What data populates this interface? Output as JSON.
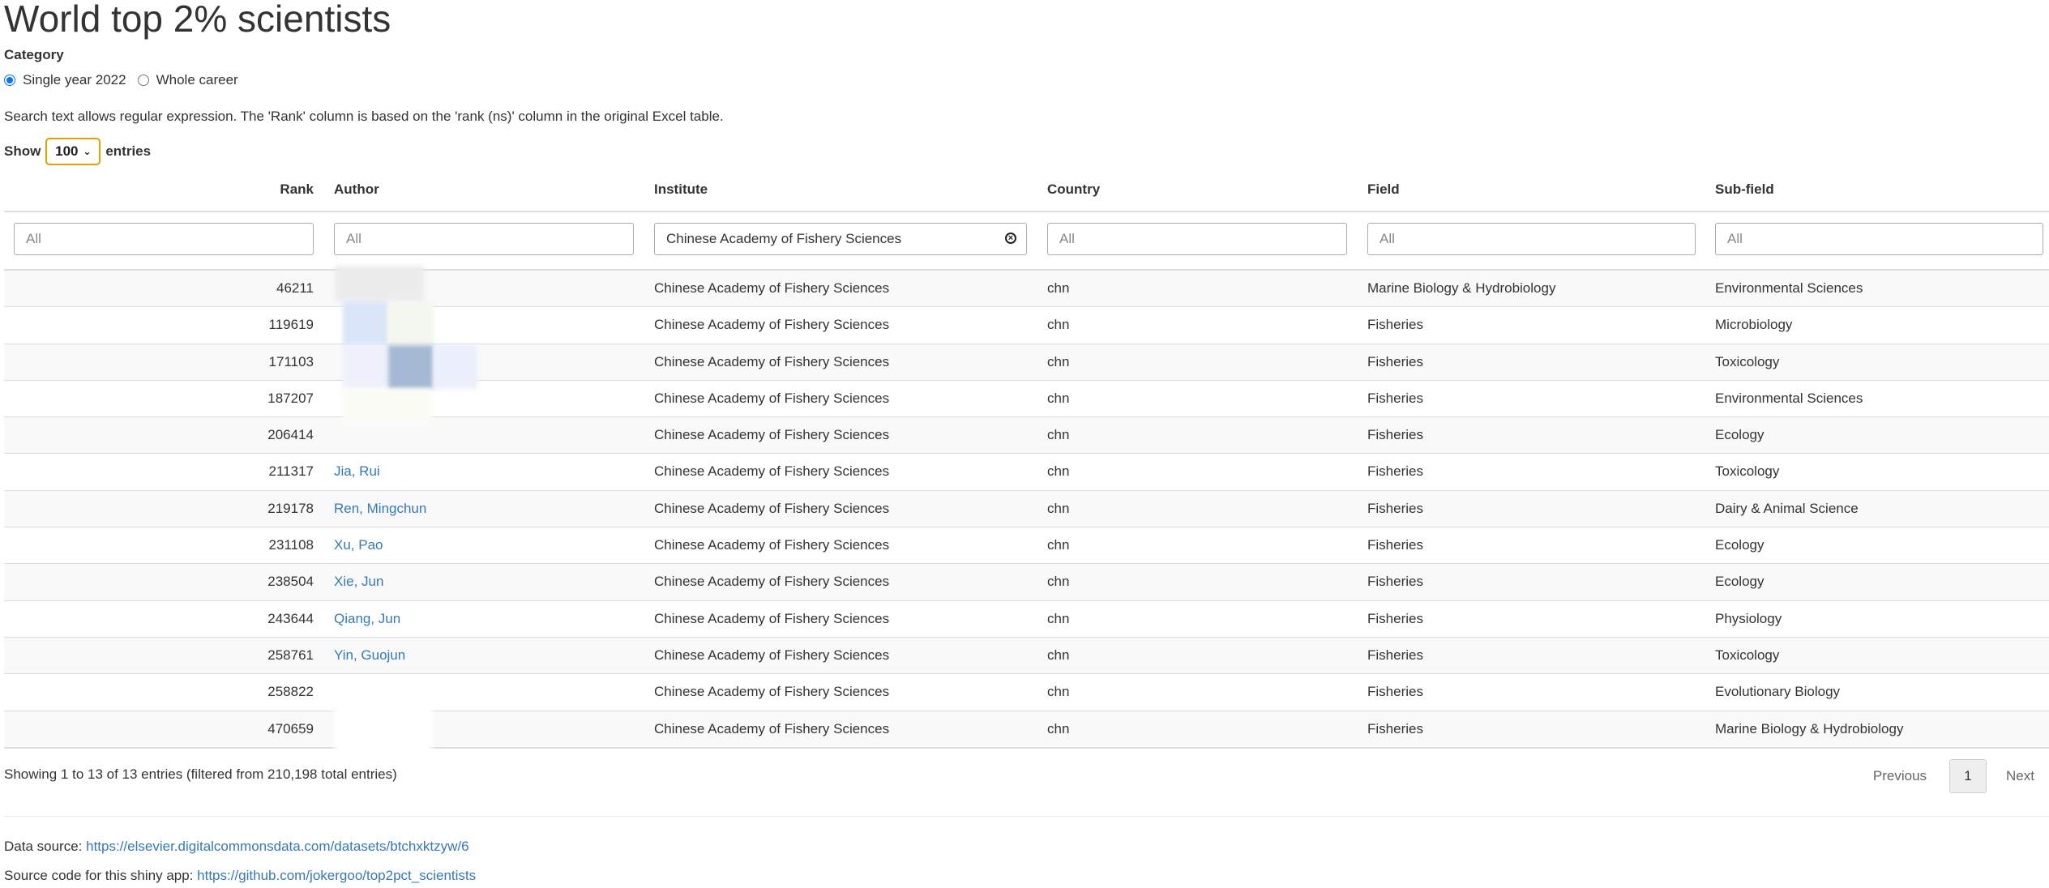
{
  "title": "World top 2% scientists",
  "category": {
    "label": "Category",
    "options": [
      {
        "label": "Single year 2022",
        "checked": true
      },
      {
        "label": "Whole career",
        "checked": false
      }
    ]
  },
  "search_help": "Search text allows regular expression. The 'Rank' column is based on the 'rank (ns)' column in the original Excel table.",
  "length_menu": {
    "show": "Show",
    "value": "100",
    "entries": "entries"
  },
  "columns": [
    "Rank",
    "Author",
    "Institute",
    "Country",
    "Field",
    "Sub-field"
  ],
  "filters": [
    {
      "value": "",
      "placeholder": "All"
    },
    {
      "value": "",
      "placeholder": "All"
    },
    {
      "value": "Chinese Academy of Fishery Sciences",
      "placeholder": "All"
    },
    {
      "value": "",
      "placeholder": "All"
    },
    {
      "value": "",
      "placeholder": "All"
    },
    {
      "value": "",
      "placeholder": "All"
    }
  ],
  "rows": [
    {
      "rank": "46211",
      "author": "",
      "institute": "Chinese Academy of Fishery Sciences",
      "country": "chn",
      "field": "Marine Biology & Hydrobiology",
      "subfield": "Environmental Sciences"
    },
    {
      "rank": "119619",
      "author": "",
      "institute": "Chinese Academy of Fishery Sciences",
      "country": "chn",
      "field": "Fisheries",
      "subfield": "Microbiology"
    },
    {
      "rank": "171103",
      "author": "",
      "institute": "Chinese Academy of Fishery Sciences",
      "country": "chn",
      "field": "Fisheries",
      "subfield": "Toxicology"
    },
    {
      "rank": "187207",
      "author": "",
      "institute": "Chinese Academy of Fishery Sciences",
      "country": "chn",
      "field": "Fisheries",
      "subfield": "Environmental Sciences"
    },
    {
      "rank": "206414",
      "author": "",
      "institute": "Chinese Academy of Fishery Sciences",
      "country": "chn",
      "field": "Fisheries",
      "subfield": "Ecology"
    },
    {
      "rank": "211317",
      "author": "Jia, Rui",
      "institute": "Chinese Academy of Fishery Sciences",
      "country": "chn",
      "field": "Fisheries",
      "subfield": "Toxicology"
    },
    {
      "rank": "219178",
      "author": "Ren, Mingchun",
      "institute": "Chinese Academy of Fishery Sciences",
      "country": "chn",
      "field": "Fisheries",
      "subfield": "Dairy & Animal Science"
    },
    {
      "rank": "231108",
      "author": "Xu, Pao",
      "institute": "Chinese Academy of Fishery Sciences",
      "country": "chn",
      "field": "Fisheries",
      "subfield": "Ecology"
    },
    {
      "rank": "238504",
      "author": "Xie, Jun",
      "institute": "Chinese Academy of Fishery Sciences",
      "country": "chn",
      "field": "Fisheries",
      "subfield": "Ecology"
    },
    {
      "rank": "243644",
      "author": "Qiang, Jun",
      "institute": "Chinese Academy of Fishery Sciences",
      "country": "chn",
      "field": "Fisheries",
      "subfield": "Physiology"
    },
    {
      "rank": "258761",
      "author": "Yin, Guojun",
      "institute": "Chinese Academy of Fishery Sciences",
      "country": "chn",
      "field": "Fisheries",
      "subfield": "Toxicology"
    },
    {
      "rank": "258822",
      "author": "",
      "institute": "Chinese Academy of Fishery Sciences",
      "country": "chn",
      "field": "Fisheries",
      "subfield": "Evolutionary Biology"
    },
    {
      "rank": "470659",
      "author": "",
      "institute": "Chinese Academy of Fishery Sciences",
      "country": "chn",
      "field": "Fisheries",
      "subfield": "Marine Biology & Hydrobiology"
    }
  ],
  "info": "Showing 1 to 13 of 13 entries (filtered from 210,198 total entries)",
  "pagination": {
    "previous": "Previous",
    "page": "1",
    "next": "Next"
  },
  "footer": {
    "data_source_label": "Data source:",
    "data_source_link": "https://elsevier.digitalcommonsdata.com/datasets/btchxktzyw/6",
    "source_code_label": "Source code for this shiny app:",
    "source_code_link": "https://github.com/jokergoo/top2pct_scientists"
  },
  "colors": {
    "link": "#337ab7",
    "accent": "#e1a100",
    "radio": "#0075ff"
  }
}
